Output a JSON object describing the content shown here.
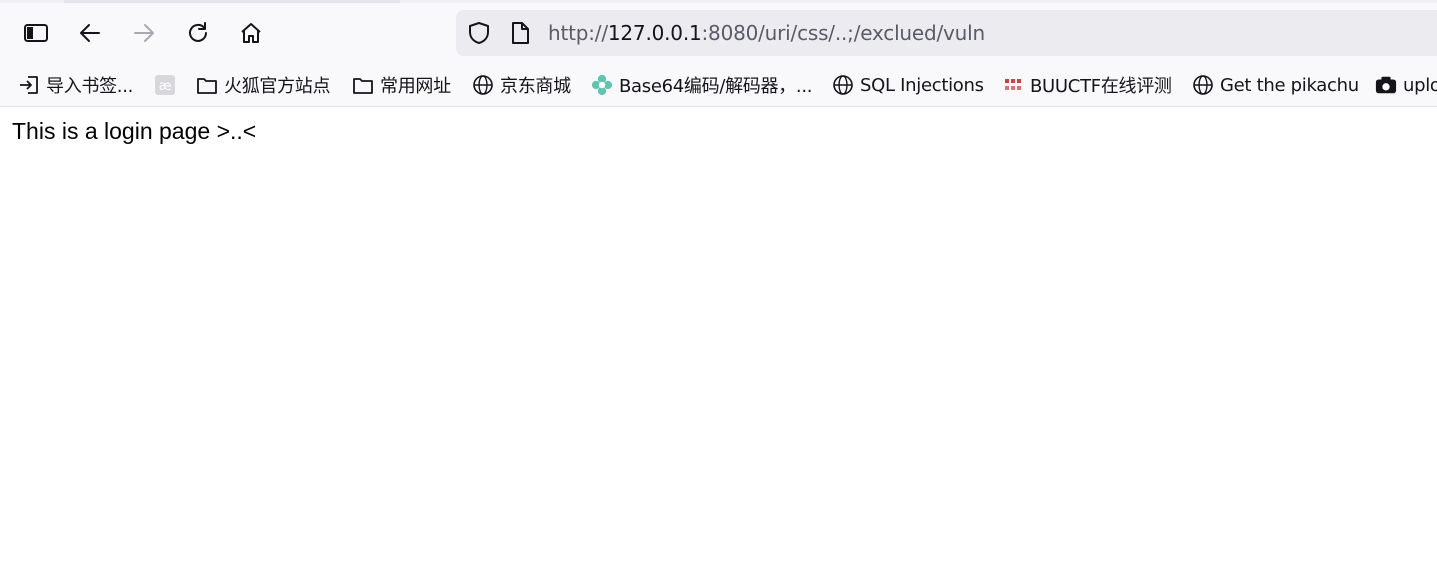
{
  "toolbar": {
    "sidebar_icon": "sidebar-icon",
    "back_icon": "arrow-left-icon",
    "forward_icon": "arrow-right-icon",
    "reload_icon": "reload-icon",
    "home_icon": "home-icon"
  },
  "urlbar": {
    "protocol": "http://",
    "host": "127.0.0.1",
    "rest": ":8080/uri/css/..;/exclued/vuln",
    "shield_icon": "shield-icon",
    "page_icon": "page-icon"
  },
  "bookmarks": [
    {
      "label": "导入书签...",
      "icon": "import-icon"
    },
    {
      "label": "",
      "icon": "ae-icon"
    },
    {
      "label": "火狐官方站点",
      "icon": "folder-icon"
    },
    {
      "label": "常用网址",
      "icon": "folder-icon"
    },
    {
      "label": "京东商城",
      "icon": "globe-icon"
    },
    {
      "label": "Base64编码/解码器，...",
      "icon": "flower-icon"
    },
    {
      "label": "SQL Injections",
      "icon": "globe-icon"
    },
    {
      "label": "BUUCTF在线评测",
      "icon": "buuctf-icon"
    },
    {
      "label": "Get the pikachu",
      "icon": "globe-icon"
    },
    {
      "label": "uplo",
      "icon": "camera-icon"
    }
  ],
  "page": {
    "body_text": "This is a login page >..<"
  },
  "colors": {
    "chrome_bg": "#f9f9fb",
    "urlbar_bg": "#ececf0",
    "text": "#15141a",
    "muted": "#5b5b66"
  }
}
